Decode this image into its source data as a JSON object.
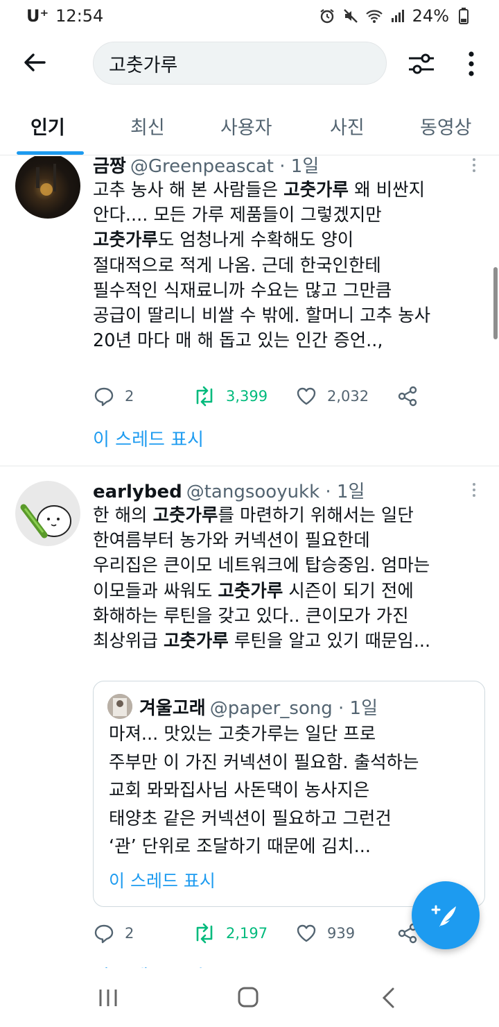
{
  "status_bar": {
    "carrier": "U⁺",
    "time": "12:54",
    "battery": "24%",
    "icons": [
      "alarm-icon",
      "mute-icon",
      "wifi-icon",
      "signal-icon",
      "battery-icon"
    ]
  },
  "header": {
    "back_icon": "arrow-left-icon",
    "search_value": "고춧가루",
    "filter_icon": "sliders-icon",
    "more_icon": "kebab-icon"
  },
  "tabs": [
    {
      "label": "인기",
      "active": true
    },
    {
      "label": "최신",
      "active": false
    },
    {
      "label": "사용자",
      "active": false
    },
    {
      "label": "사진",
      "active": false
    },
    {
      "label": "동영상",
      "active": false
    }
  ],
  "tweets": [
    {
      "name": "금짱",
      "handle": "@Greenpeascat · 1일",
      "lines": [
        [
          "고추 농사 해 본 사람들은 ",
          "고춧가루",
          " 왜 비싼지"
        ],
        [
          "안다.... 모든 가루 제품들이 그렇겠지만"
        ],
        [
          "",
          "고춧가루",
          "도 엄청나게 수확해도 양이"
        ],
        [
          "절대적으로 적게 나옴. 근데 한국인한테"
        ],
        [
          "필수적인 식재료니까 수요는 많고 그만큼"
        ],
        [
          "공급이 딸리니 비쌀 수 밖에. 할머니 고추 농사"
        ],
        [
          "20년 마다 매 해 돕고 있는 인간 증언..,"
        ]
      ],
      "replies": "2",
      "retweets": "3,399",
      "likes": "2,032",
      "thread_link": "이 스레드 표시"
    },
    {
      "name": "earlybed",
      "handle": "@tangsooyukk · 1일",
      "lines": [
        [
          "한 해의 ",
          "고춧가루",
          "를 마련하기 위해서는 일단"
        ],
        [
          "한여름부터 농가와 커넥션이 필요한데"
        ],
        [
          "우리집은 큰이모 네트워크에 탑승중임. 엄마는"
        ],
        [
          "이모들과 싸워도 ",
          "고춧가루",
          " 시즌이 되기 전에"
        ],
        [
          "화해하는 루틴을 갖고 있다.. 큰이모가 가진"
        ],
        [
          "최상위급 ",
          "고춧가루",
          " 루틴을 알고 있기 때문임..."
        ]
      ],
      "quote": {
        "name": "겨울고래",
        "handle": "@paper_song · 1일",
        "lines": [
          "마져... 맛있는 고춧가루는 일단 프로",
          "주부만 이 가진 커넥션이 필요함. 출석하는",
          "교회 뫄뫄집사님 사돈댁이 농사지은",
          "태양초 같은 커넥션이 필요하고 그런건",
          "‘관’ 단위로 조달하기 때문에 김치..."
        ],
        "thread_link": "이 스레드 표시"
      },
      "replies": "2",
      "retweets": "2,197",
      "likes": "939",
      "thread_link": "이 스레드 표시"
    }
  ],
  "fab_icon": "compose-tweet-icon",
  "nav_bar": {
    "icons": [
      "recent-apps-icon",
      "home-icon",
      "back-icon"
    ]
  },
  "colors": {
    "accent": "#1d9bf0",
    "retweet": "#00ba7c",
    "secondary_text": "#536471",
    "primary_text": "#0f1419"
  }
}
